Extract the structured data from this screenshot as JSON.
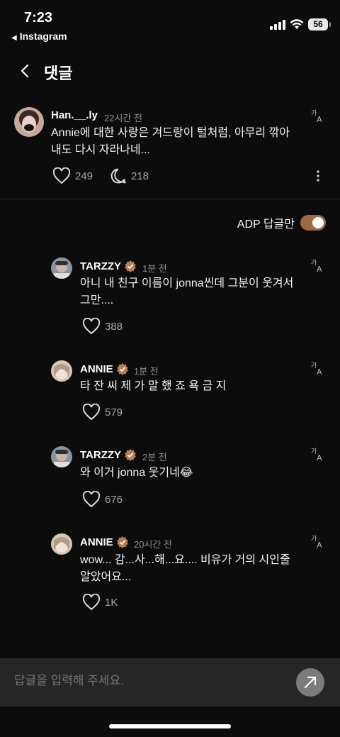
{
  "status": {
    "time": "7:23",
    "back_app": "Instagram",
    "battery": "56"
  },
  "header": {
    "title": "댓글"
  },
  "parent_comment": {
    "username": "Han.__.ly",
    "time": "22시간 전",
    "text_line1": "Annie에 대한 사랑은 겨드랑이 털처럼, 아무리 깎아",
    "text_line2": "내도 다시 자라나네...",
    "likes": "249",
    "replies": "218"
  },
  "filter": {
    "label": "ADP 답글만",
    "enabled": true
  },
  "replies": [
    {
      "username": "TARZZY",
      "time": "1분 전",
      "text_line1": "아니 내 친구 이름이 jonna씬데 그분이 웃겨서",
      "text_line2": "그만....",
      "likes": "388"
    },
    {
      "username": "ANNIE",
      "time": "1분 전",
      "text_line1": "타 잔 씨 제 가 말 했 죠 욕 금 지",
      "text_line2": "",
      "likes": "579"
    },
    {
      "username": "TARZZY",
      "time": "2분 전",
      "text_line1": "와 이거 jonna 웃기네😂",
      "text_line2": "",
      "likes": "676"
    },
    {
      "username": "ANNIE",
      "time": "20시간 전",
      "text_line1": "wow... 감...사...해...요.... 비유가 거의 시인줄",
      "text_line2": "알았어요...",
      "likes": "1K"
    }
  ],
  "reply_box": {
    "placeholder": "답글을 입력해 주세요."
  },
  "colors": {
    "background": "#0c0c0c",
    "accent": "#a0693d",
    "muted": "#8e8e8e"
  }
}
